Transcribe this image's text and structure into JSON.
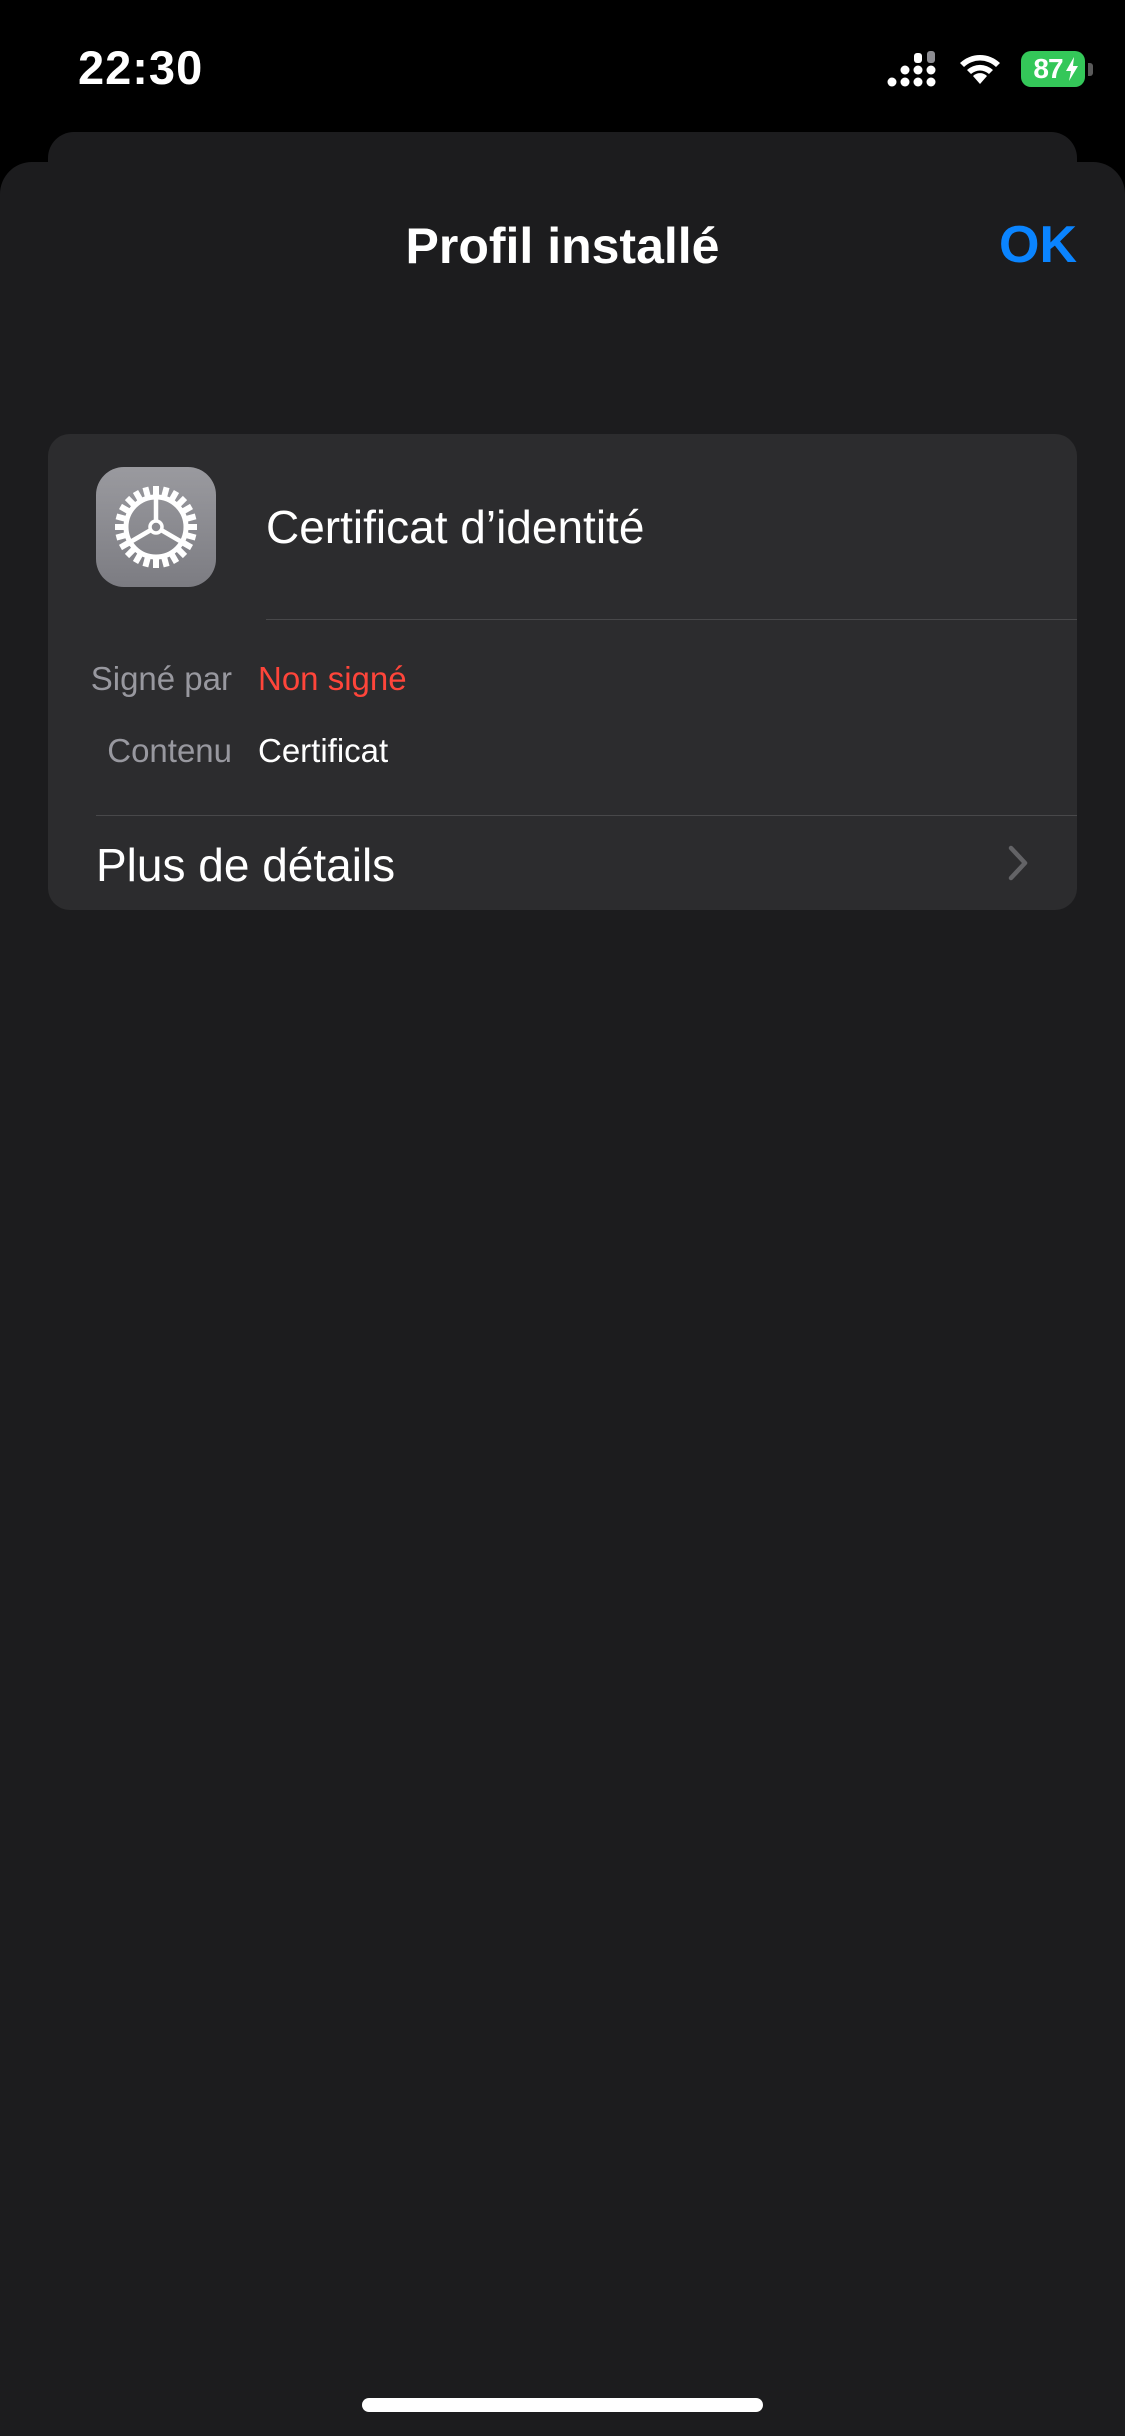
{
  "status_bar": {
    "time": "22:30",
    "battery": "87",
    "icons": [
      "signal-icon",
      "wifi-icon",
      "battery-icon",
      "charging-bolt-icon"
    ]
  },
  "nav": {
    "title": "Profil installé",
    "done_label": "OK"
  },
  "profile": {
    "name": "Certificat d’identité",
    "icon": "settings-gear-icon",
    "details": [
      {
        "label": "Signé par",
        "value": "Non signé",
        "value_color": "#ff453a"
      },
      {
        "label": "Contenu",
        "value": "Certificat",
        "value_color": "#ffffff"
      }
    ],
    "more_details_label": "Plus de détails"
  },
  "colors": {
    "accent": "#0a84ff",
    "warning": "#ff453a",
    "battery": "#34c759",
    "background": "#1c1c1e",
    "card": "#2c2c2e"
  }
}
